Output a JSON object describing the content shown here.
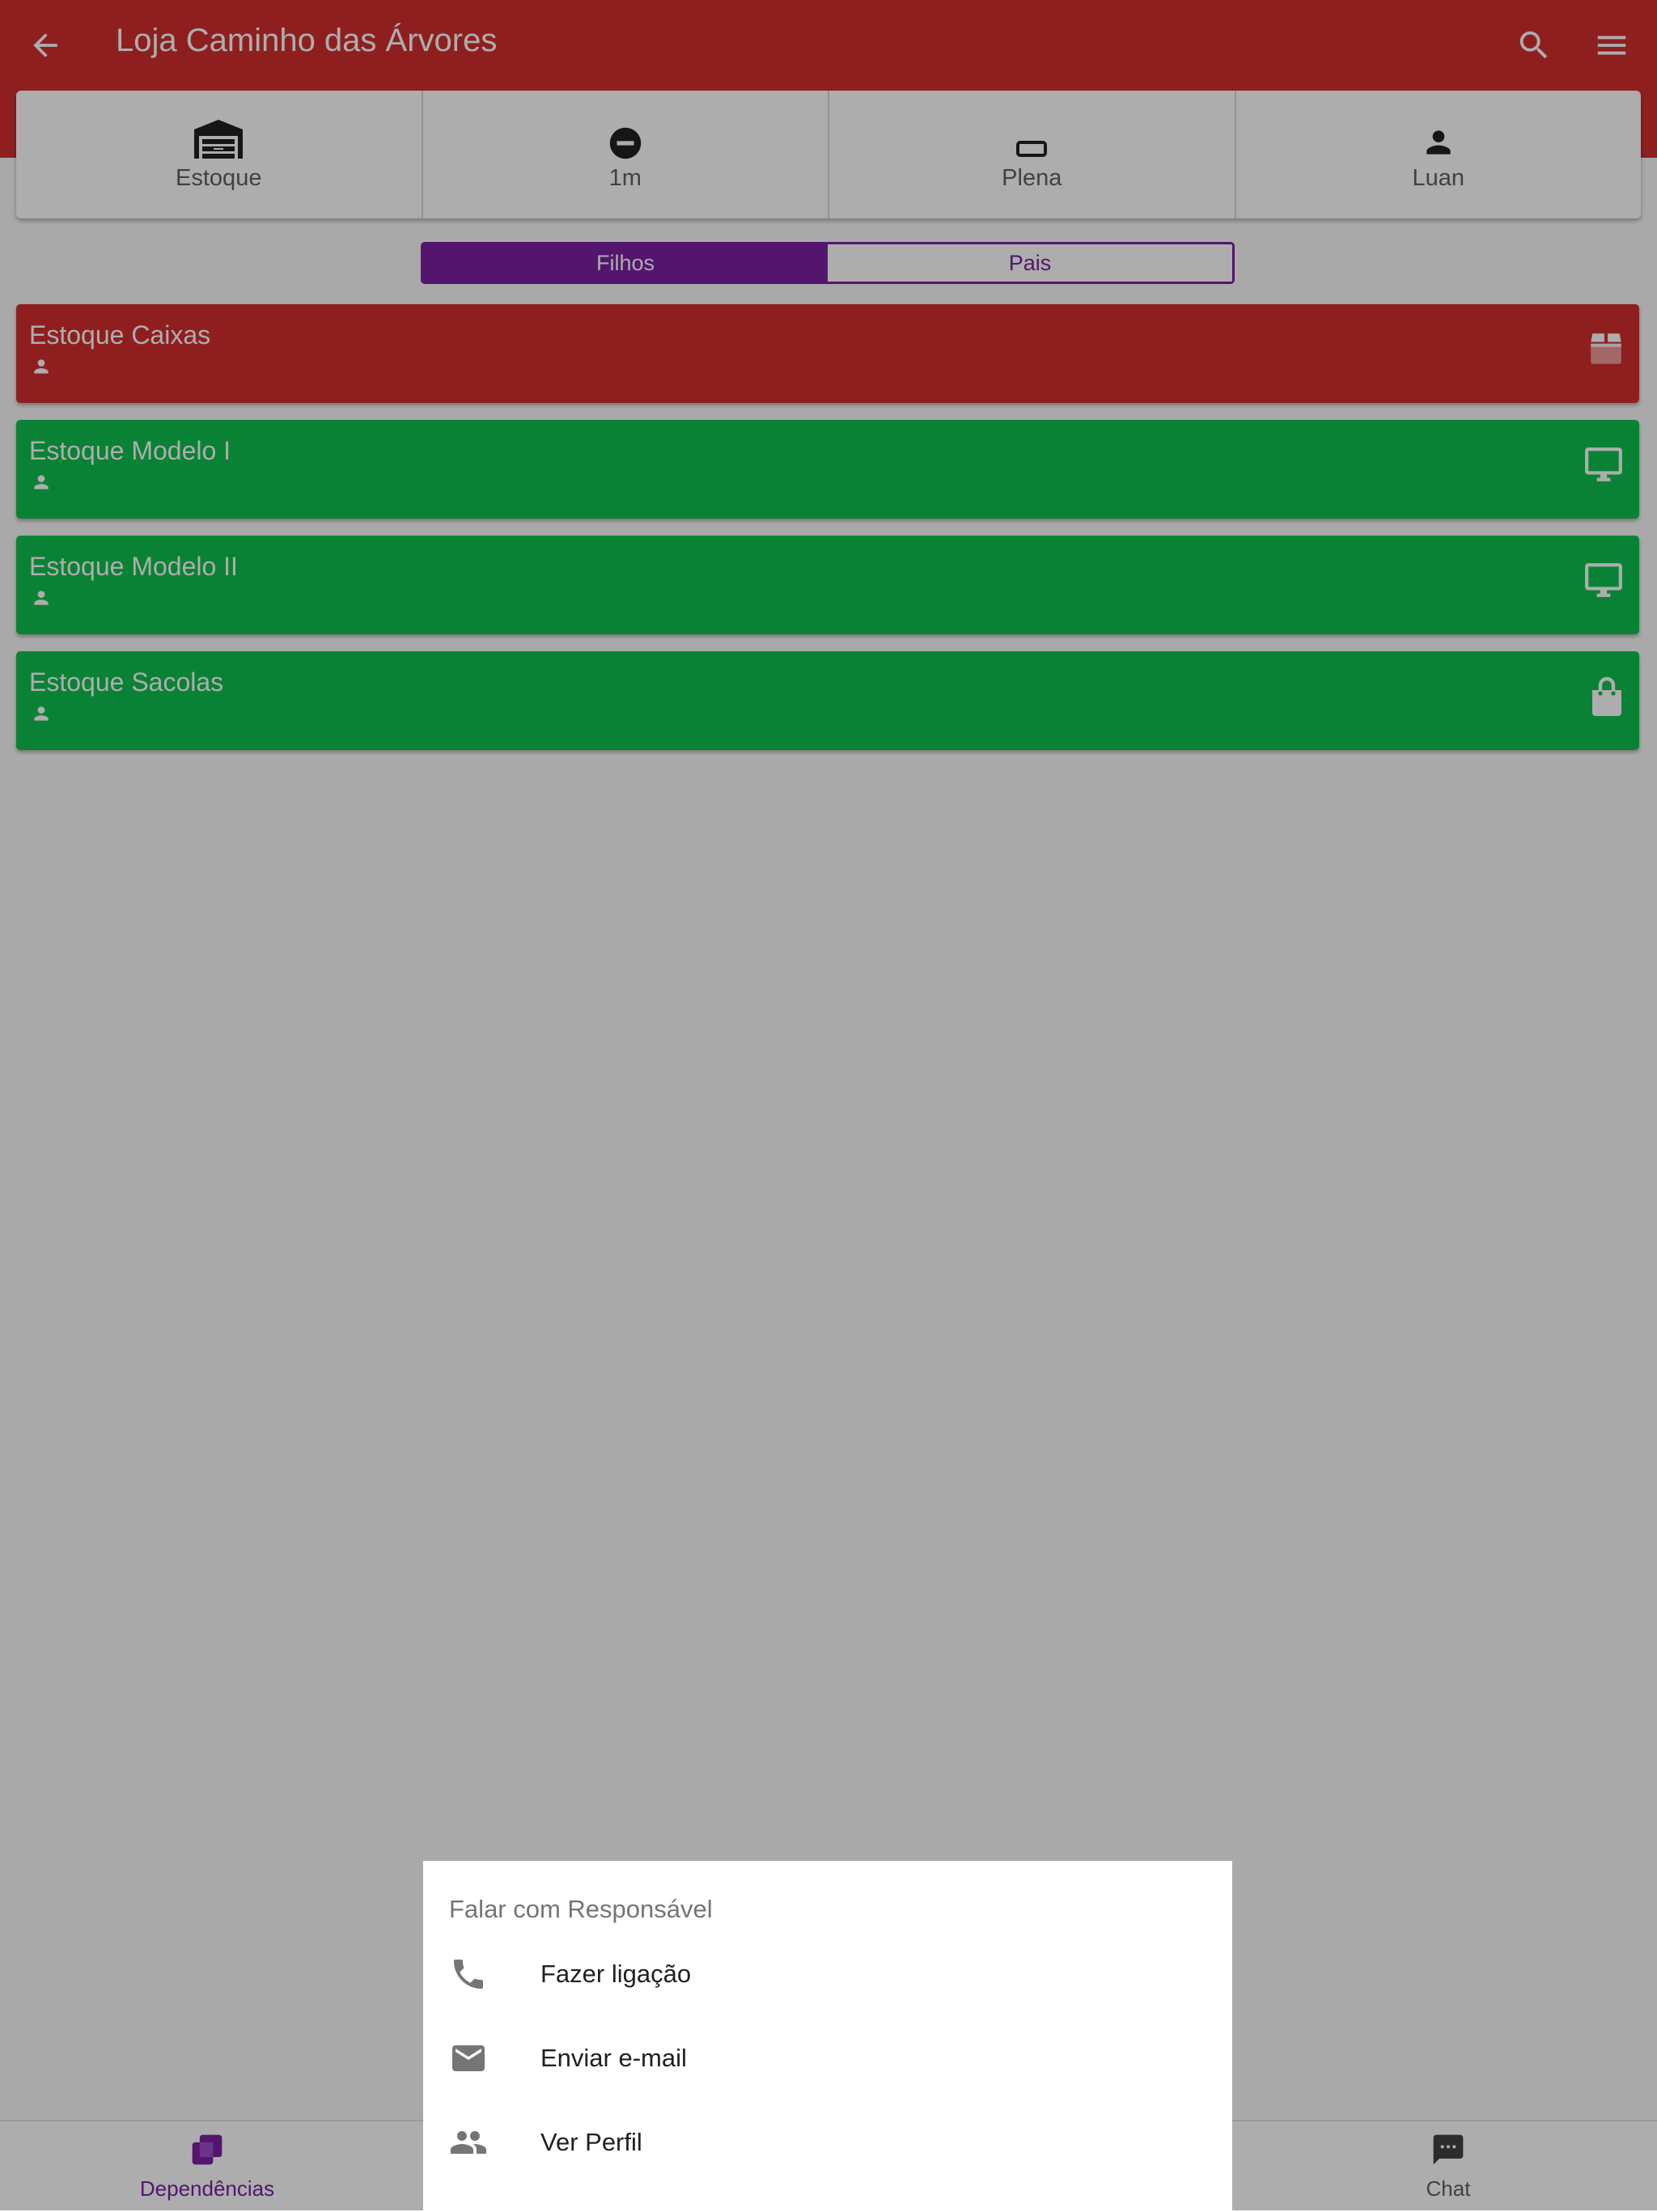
{
  "appbar": {
    "title": "Loja Caminho das Árvores",
    "back_icon": "arrow-back-icon",
    "search_icon": "search-icon",
    "menu_icon": "menu-icon",
    "color": "#d32f2f"
  },
  "info": {
    "type": {
      "label": "Estoque",
      "icon": "warehouse-icon"
    },
    "time": {
      "label": "1m",
      "icon": "minus-circle-icon"
    },
    "status": {
      "label": "Plena",
      "icon": "crop-icon"
    },
    "user": {
      "label": "Luan",
      "icon": "person-icon"
    }
  },
  "segment": {
    "active": "Filhos",
    "inactive": "Pais",
    "accent": "#7b1fa2"
  },
  "items": [
    {
      "name": "Estoque Caixas",
      "color": "#d32f2f",
      "icon": "box-icon"
    },
    {
      "name": "Estoque Modelo I",
      "color": "#0fc04e",
      "icon": "monitor-icon"
    },
    {
      "name": "Estoque Modelo II",
      "color": "#0fc04e",
      "icon": "monitor-icon"
    },
    {
      "name": "Estoque Sacolas",
      "color": "#0fc04e",
      "icon": "shopping-bag-icon"
    }
  ],
  "bottomnav": {
    "left": {
      "label": "Dependências",
      "icon": "dependencies-icon",
      "color": "#7b1fa2"
    },
    "right": {
      "label": "Chat",
      "icon": "chat-icon",
      "color": "#616161"
    }
  },
  "sheet": {
    "title": "Falar com Responsável",
    "actions": [
      {
        "label": "Fazer ligação",
        "icon": "phone-icon"
      },
      {
        "label": "Enviar e-mail",
        "icon": "mail-icon"
      },
      {
        "label": "Ver Perfil",
        "icon": "people-icon"
      }
    ]
  }
}
